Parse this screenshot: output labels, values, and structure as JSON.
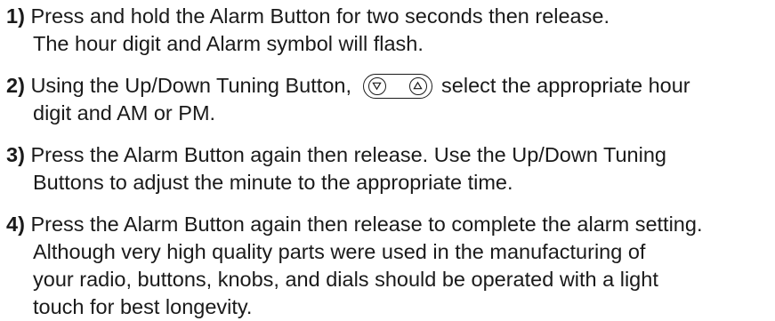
{
  "steps": [
    {
      "number": "1)",
      "lines": [
        "Press and hold the Alarm Button for two seconds then release.",
        "The hour digit and Alarm symbol will flash."
      ]
    },
    {
      "number": "2)",
      "line1_before": "Using the Up/Down Tuning Button,",
      "line1_after": "select the appropriate hour",
      "line2": "digit and AM or PM."
    },
    {
      "number": "3)",
      "lines": [
        "Press the Alarm Button again then release. Use the Up/Down Tuning",
        "Buttons to adjust the minute to the appropriate time."
      ]
    },
    {
      "number": "4)",
      "lines": [
        "Press the Alarm Button again then release to complete the alarm setting.",
        "Although very high quality parts were used in the manufacturing of",
        "your radio, buttons, knobs, and dials should be operated with a light",
        "touch for best longevity."
      ]
    }
  ],
  "icons": {
    "tuning_button": "up-down-tuning-button-icon",
    "down": "down-triangle-icon",
    "up": "up-triangle-icon"
  }
}
